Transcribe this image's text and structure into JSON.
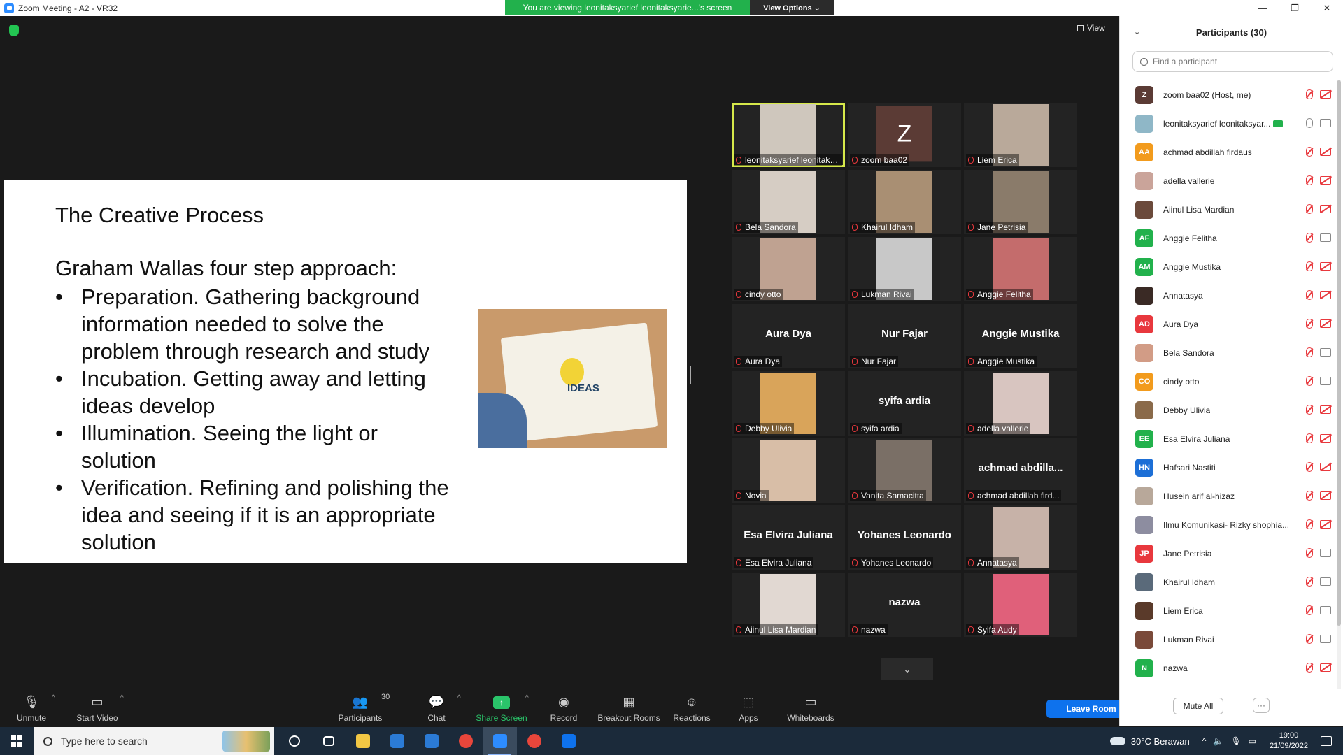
{
  "window": {
    "title": "Zoom Meeting - A2 - VR32",
    "controls": [
      "—",
      "❐",
      "✕"
    ]
  },
  "banner": {
    "message": "You are viewing leonitaksyarief leonitaksyarie...'s screen",
    "view_options": "View Options ⌄"
  },
  "view_label": "View",
  "slide": {
    "title": "The Creative Process",
    "subtitle": "Graham Wallas four step approach:",
    "bullets": [
      "Preparation. Gathering background information needed to solve the problem through research and study",
      "Incubation. Getting away and letting ideas develop",
      "Illumination. Seeing the light or solution",
      "Verification. Refining and polishing the idea and seeing if it is an appropriate solution"
    ],
    "image_word": "IDEAS"
  },
  "gallery": [
    {
      "name": "leonitaksyarief leonitaksy...",
      "kind": "video",
      "color": "#cfc7bd",
      "active": true
    },
    {
      "name": "zoom baa02",
      "kind": "letter",
      "letter": "Z",
      "color": "#5b3b35"
    },
    {
      "name": "Liem Erica",
      "kind": "video",
      "color": "#b9a99a"
    },
    {
      "name": "Bela Sandora",
      "kind": "video",
      "color": "#d6cdc4"
    },
    {
      "name": "Khairul Idham",
      "kind": "video",
      "color": "#a98f73"
    },
    {
      "name": "Jane Petrisia",
      "kind": "video",
      "color": "#8a7b6a"
    },
    {
      "name": "cindy otto",
      "kind": "video",
      "color": "#bfa291"
    },
    {
      "name": "Lukman Rivai",
      "kind": "video",
      "color": "#c8c8c8"
    },
    {
      "name": "Anggie Felitha",
      "kind": "video",
      "color": "#c46c6c"
    },
    {
      "name": "Aura Dya",
      "kind": "name",
      "big": "Aura Dya"
    },
    {
      "name": "Nur Fajar",
      "kind": "name",
      "big": "Nur Fajar"
    },
    {
      "name": "Anggie Mustika",
      "kind": "name",
      "big": "Anggie Mustika"
    },
    {
      "name": "Debby Ulivia",
      "kind": "video",
      "color": "#d9a45a"
    },
    {
      "name": "syifa ardia",
      "kind": "name",
      "big": "syifa ardia"
    },
    {
      "name": "adella vallerie",
      "kind": "video",
      "color": "#d8c5c0"
    },
    {
      "name": "Novia",
      "kind": "video",
      "color": "#d8bea7"
    },
    {
      "name": "Vanita Samacitta",
      "kind": "video",
      "color": "#7a6f66"
    },
    {
      "name": "achmad abdillah fird...",
      "kind": "name",
      "big": "achmad  abdilla..."
    },
    {
      "name": "Esa Elvira Juliana",
      "kind": "name",
      "big": "Esa Elvira Juliana"
    },
    {
      "name": "Yohanes Leonardo",
      "kind": "name",
      "big": "Yohanes Leonardo"
    },
    {
      "name": "Annatasya",
      "kind": "video",
      "color": "#c7b2a8"
    },
    {
      "name": "Aiinul Lisa Mardian",
      "kind": "video",
      "color": "#e1d8d2"
    },
    {
      "name": "nazwa",
      "kind": "name",
      "big": "nazwa"
    },
    {
      "name": "Syifa Audy",
      "kind": "video",
      "color": "#e0607a"
    }
  ],
  "toolbar": {
    "unmute": "Unmute",
    "start_video": "Start Video",
    "participants": "Participants",
    "participants_count": "30",
    "chat": "Chat",
    "share_screen": "Share Screen",
    "record": "Record",
    "breakout_rooms": "Breakout Rooms",
    "reactions": "Reactions",
    "apps": "Apps",
    "whiteboards": "Whiteboards",
    "leave": "Leave Room"
  },
  "panel": {
    "title": "Participants (30)",
    "search_placeholder": "Find a participant",
    "mute_all": "Mute All",
    "more": "···",
    "participants": [
      {
        "name": "zoom baa02 (Host, me)",
        "avatar": "Z",
        "color": "#5b3b35",
        "mic_on": false,
        "video_on": false
      },
      {
        "name": "leonitaksyarief leonitaksyar...",
        "avatar": "",
        "color": "#8fb7c7",
        "mic_on": true,
        "video_on": true,
        "sharing": true
      },
      {
        "name": "achmad abdillah firdaus",
        "avatar": "AA",
        "color": "#f29b1d",
        "mic_on": false,
        "video_on": false
      },
      {
        "name": "adella vallerie",
        "avatar": "",
        "color": "#caa49a",
        "mic_on": false,
        "video_on": false
      },
      {
        "name": "Aiinul Lisa Mardian",
        "avatar": "",
        "color": "#6b4a3b",
        "mic_on": false,
        "video_on": false
      },
      {
        "name": "Anggie Felitha",
        "avatar": "AF",
        "color": "#22b14c",
        "mic_on": false,
        "video_on": true
      },
      {
        "name": "Anggie Mustika",
        "avatar": "AM",
        "color": "#22b14c",
        "mic_on": false,
        "video_on": false
      },
      {
        "name": "Annatasya",
        "avatar": "",
        "color": "#3a2a25",
        "mic_on": false,
        "video_on": false
      },
      {
        "name": "Aura Dya",
        "avatar": "AD",
        "color": "#e8383d",
        "mic_on": false,
        "video_on": false
      },
      {
        "name": "Bela Sandora",
        "avatar": "",
        "color": "#d29c86",
        "mic_on": false,
        "video_on": true
      },
      {
        "name": "cindy otto",
        "avatar": "CO",
        "color": "#f29b1d",
        "mic_on": false,
        "video_on": true
      },
      {
        "name": "Debby Ulivia",
        "avatar": "",
        "color": "#8a6a4a",
        "mic_on": false,
        "video_on": false
      },
      {
        "name": "Esa Elvira Juliana",
        "avatar": "EE",
        "color": "#22b14c",
        "mic_on": false,
        "video_on": false
      },
      {
        "name": "Hafsari Nastiti",
        "avatar": "HN",
        "color": "#1d6fd6",
        "mic_on": false,
        "video_on": false
      },
      {
        "name": "Husein arif al-hizaz",
        "avatar": "",
        "color": "#b8a89a",
        "mic_on": false,
        "video_on": false
      },
      {
        "name": "Ilmu Komunikasi- Rizky shophia...",
        "avatar": "",
        "color": "#8d8da0",
        "mic_on": false,
        "video_on": false
      },
      {
        "name": "Jane Petrisia",
        "avatar": "JP",
        "color": "#e8383d",
        "mic_on": false,
        "video_on": true
      },
      {
        "name": "Khairul Idham",
        "avatar": "",
        "color": "#5a6a7a",
        "mic_on": false,
        "video_on": true
      },
      {
        "name": "Liem Erica",
        "avatar": "",
        "color": "#5a3a2a",
        "mic_on": false,
        "video_on": true
      },
      {
        "name": "Lukman Rivai",
        "avatar": "",
        "color": "#7a4a3a",
        "mic_on": false,
        "video_on": true
      },
      {
        "name": "nazwa",
        "avatar": "N",
        "color": "#22b14c",
        "mic_on": false,
        "video_on": false
      }
    ]
  },
  "taskbar": {
    "search_placeholder": "Type here to search",
    "weather": "30°C  Berawan",
    "time": "19:00",
    "date": "21/09/2022",
    "apps": [
      {
        "name": "cortana",
        "color": "transparent"
      },
      {
        "name": "task-view",
        "color": "transparent"
      },
      {
        "name": "file-explorer",
        "color": "#f2c744"
      },
      {
        "name": "store",
        "color": "#2b7bd6"
      },
      {
        "name": "mail",
        "color": "#2b7bd6"
      },
      {
        "name": "chrome",
        "color": "#e8463b"
      },
      {
        "name": "zoom",
        "color": "#2d8cff",
        "active": true
      },
      {
        "name": "chrome-2",
        "color": "#e8463b"
      },
      {
        "name": "teamviewer",
        "color": "#0e72ed"
      }
    ]
  }
}
